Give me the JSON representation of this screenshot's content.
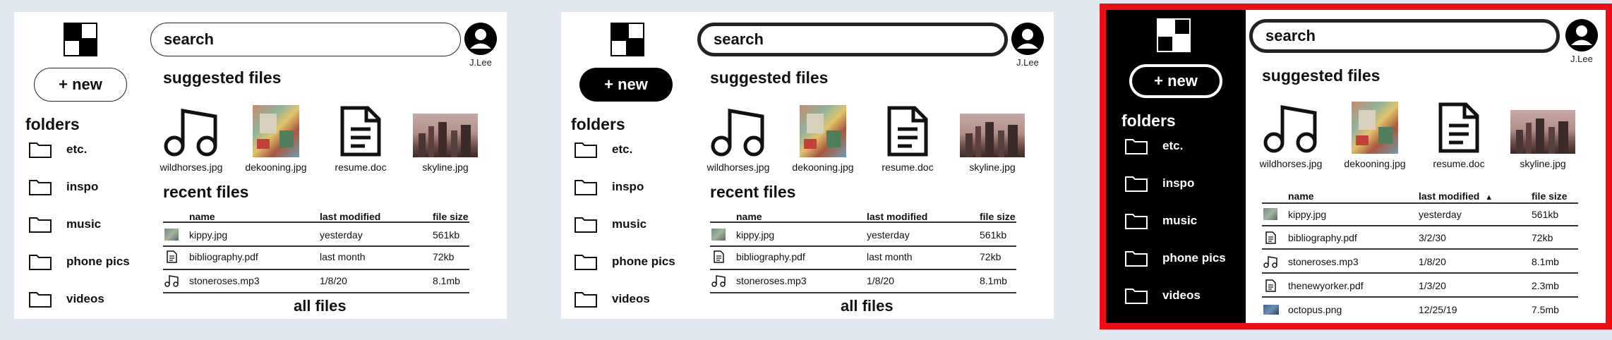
{
  "colors": {
    "background": "#e2e8f0",
    "highlight": "#ee0d12",
    "sidebar_dark": "#000000"
  },
  "search": {
    "placeholder": "search"
  },
  "user": {
    "name": "J.Lee"
  },
  "new_button": {
    "label": "+ new"
  },
  "folders": {
    "title": "folders",
    "items": [
      {
        "label": "etc.",
        "icon": "folder-icon"
      },
      {
        "label": "inspo",
        "icon": "folder-icon"
      },
      {
        "label": "music",
        "icon": "folder-icon"
      },
      {
        "label": "phone pics",
        "icon": "folder-icon"
      },
      {
        "label": "videos",
        "icon": "folder-icon"
      }
    ]
  },
  "suggested": {
    "title": "suggested files",
    "items": [
      {
        "label": "wildhorses.jpg",
        "icon": "music-note-icon"
      },
      {
        "label": "dekooning.jpg",
        "icon": "abstract-painting-thumbnail"
      },
      {
        "label": "resume.doc",
        "icon": "document-icon"
      },
      {
        "label": "skyline.jpg",
        "icon": "city-skyline-thumbnail"
      }
    ]
  },
  "recent": {
    "title": "recent files",
    "columns": {
      "name": "name",
      "modified": "last modified",
      "size": "file size"
    },
    "rows": [
      {
        "name": "kippy.jpg",
        "modified": "yesterday",
        "size": "561kb",
        "icon": "image-thumbnail"
      },
      {
        "name": "bibliography.pdf",
        "modified": "last month",
        "size": "72kb",
        "icon": "document-icon"
      },
      {
        "name": "stoneroses.mp3",
        "modified": "1/8/20",
        "size": "8.1mb",
        "icon": "music-note-icon"
      }
    ],
    "all_files_label": "all files"
  },
  "all_files_view": {
    "columns": {
      "name": "name",
      "modified": "last modified",
      "size": "file size",
      "sort_indicator": "▲"
    },
    "rows": [
      {
        "name": "kippy.jpg",
        "modified": "yesterday",
        "size": "561kb",
        "icon": "image-thumbnail"
      },
      {
        "name": "bibliography.pdf",
        "modified": "3/2/30",
        "size": "72kb",
        "icon": "document-icon"
      },
      {
        "name": "stoneroses.mp3",
        "modified": "1/8/20",
        "size": "8.1mb",
        "icon": "music-note-icon"
      },
      {
        "name": "thenewyorker.pdf",
        "modified": "1/3/20",
        "size": "2.3mb",
        "icon": "document-icon"
      },
      {
        "name": "octopus.png",
        "modified": "12/25/19",
        "size": "7.5mb",
        "icon": "image-thumbnail"
      }
    ]
  }
}
